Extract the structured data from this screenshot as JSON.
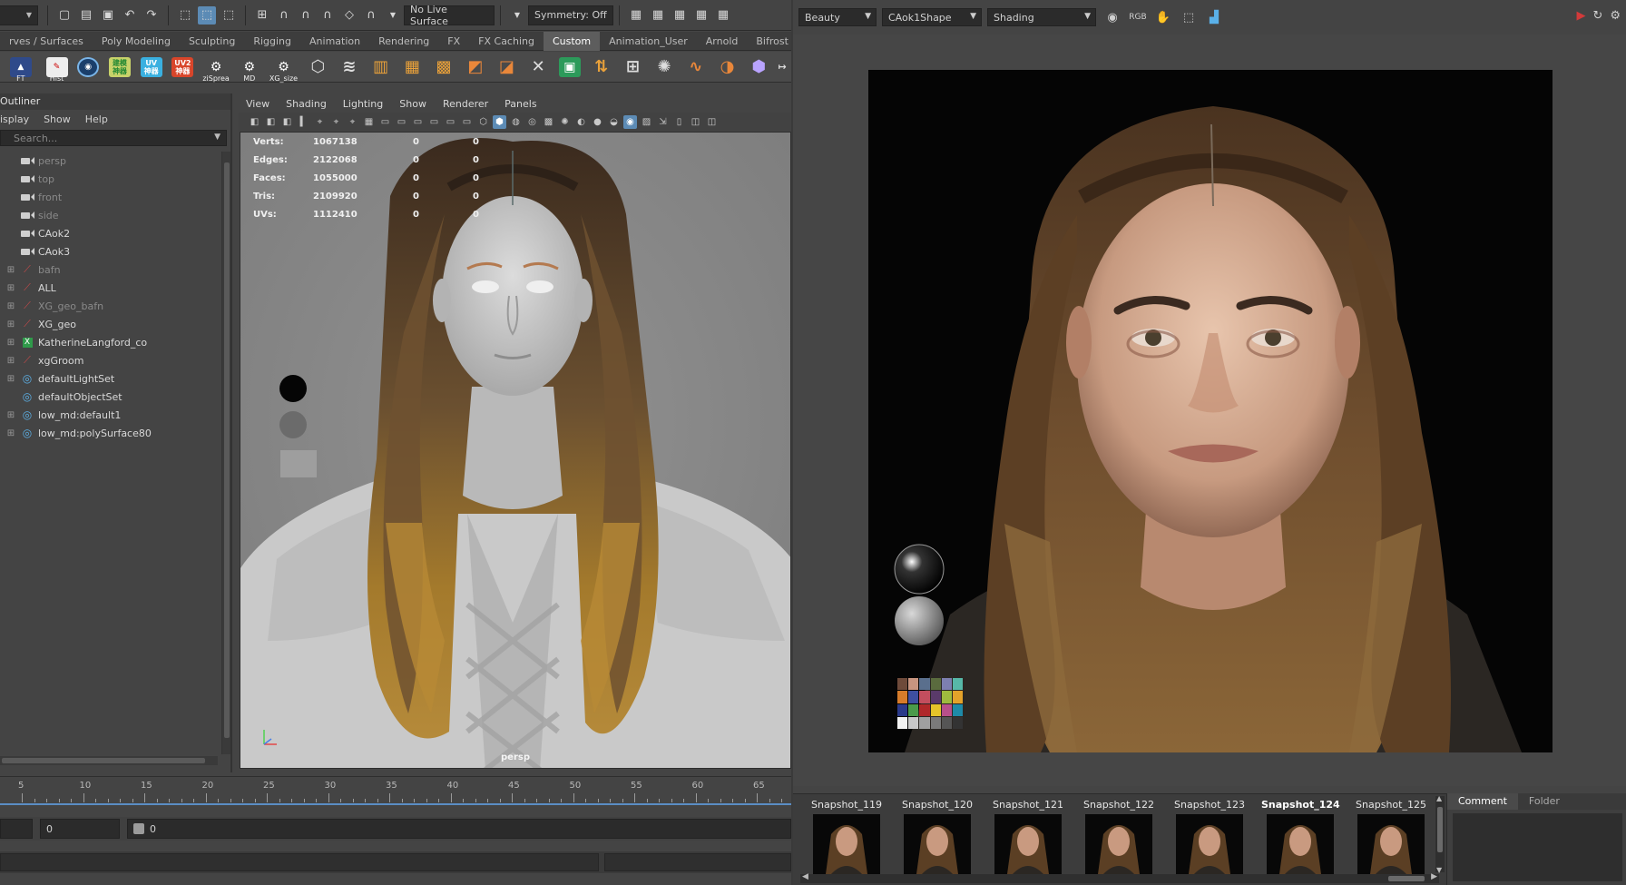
{
  "maya": {
    "topbar": {
      "live_surface": "No Live Surface",
      "symmetry": "Symmetry: Off"
    },
    "shelf_tabs": [
      "rves / Surfaces",
      "Poly Modeling",
      "Sculpting",
      "Rigging",
      "Animation",
      "Rendering",
      "FX",
      "FX Caching",
      "Custom",
      "Animation_User",
      "Arnold",
      "Bifrost"
    ],
    "active_shelf_tab": "Custom",
    "shelf_labels": {
      "ft": "FT",
      "hist": "Hist",
      "jp1": "建模\n神器",
      "uv": "UV\n神器",
      "uv2": "UV2\n神器",
      "zispread": "ziSprea",
      "md": "MD",
      "xgsize": "XG_size"
    },
    "outliner": {
      "title": "Outliner",
      "menu": [
        "isplay",
        "Show",
        "Help"
      ],
      "search_placeholder": "Search...",
      "items": [
        {
          "label": "persp",
          "icon": "camera-icon",
          "dim": true,
          "expandable": false
        },
        {
          "label": "top",
          "icon": "camera-icon",
          "dim": true,
          "expandable": false
        },
        {
          "label": "front",
          "icon": "camera-icon",
          "dim": true,
          "expandable": false
        },
        {
          "label": "side",
          "icon": "camera-icon",
          "dim": true,
          "expandable": false
        },
        {
          "label": "CAok2",
          "icon": "camera-icon",
          "dim": false,
          "expandable": false
        },
        {
          "label": "CAok3",
          "icon": "camera-icon",
          "dim": false,
          "expandable": false
        },
        {
          "label": "bafn",
          "icon": "transform-icon",
          "dim": true,
          "expandable": true
        },
        {
          "label": "ALL",
          "icon": "transform-icon",
          "dim": false,
          "expandable": true
        },
        {
          "label": "XG_geo_bafn",
          "icon": "transform-icon",
          "dim": true,
          "expandable": true
        },
        {
          "label": "XG_geo",
          "icon": "transform-icon",
          "dim": false,
          "expandable": true
        },
        {
          "label": "KatherineLangford_co",
          "icon": "xgen-icon",
          "dim": false,
          "expandable": true
        },
        {
          "label": "xgGroom",
          "icon": "transform-icon",
          "dim": false,
          "expandable": true
        },
        {
          "label": "defaultLightSet",
          "icon": "set-icon",
          "dim": false,
          "expandable": true
        },
        {
          "label": "defaultObjectSet",
          "icon": "set-icon",
          "dim": false,
          "expandable": false
        },
        {
          "label": "low_md:default1",
          "icon": "set-icon",
          "dim": false,
          "expandable": true
        },
        {
          "label": "low_md:polySurface80",
          "icon": "set-icon",
          "dim": false,
          "expandable": true
        }
      ]
    },
    "viewport": {
      "menu": [
        "View",
        "Shading",
        "Lighting",
        "Show",
        "Renderer",
        "Panels"
      ],
      "hud": [
        {
          "k": "Verts:",
          "v": "1067138",
          "a": "0",
          "b": "0"
        },
        {
          "k": "Edges:",
          "v": "2122068",
          "a": "0",
          "b": "0"
        },
        {
          "k": "Faces:",
          "v": "1055000",
          "a": "0",
          "b": "0"
        },
        {
          "k": "Tris:",
          "v": "2109920",
          "a": "0",
          "b": "0"
        },
        {
          "k": "UVs:",
          "v": "1112410",
          "a": "0",
          "b": "0"
        }
      ],
      "camera": "persp"
    },
    "timeline": {
      "ticks": [
        "5",
        "10",
        "15",
        "20",
        "25",
        "30",
        "35",
        "40",
        "45",
        "50",
        "55",
        "60",
        "65"
      ]
    },
    "range": {
      "start": "0",
      "end": "0"
    }
  },
  "render_view": {
    "layer": "Beauty",
    "camera": "CAok1Shape",
    "aov": "Shading",
    "snapshots": [
      "Snapshot_119",
      "Snapshot_120",
      "Snapshot_121",
      "Snapshot_122",
      "Snapshot_123",
      "Snapshot_124",
      "Snapshot_125"
    ],
    "selected_snapshot": "Snapshot_124",
    "side_tabs": [
      "Comment",
      "Folder"
    ],
    "active_side_tab": "Comment"
  },
  "colors": {
    "accent": "#5c8bb5",
    "timeline": "#5a8dc4",
    "active_tab": "#5d5d5d"
  }
}
